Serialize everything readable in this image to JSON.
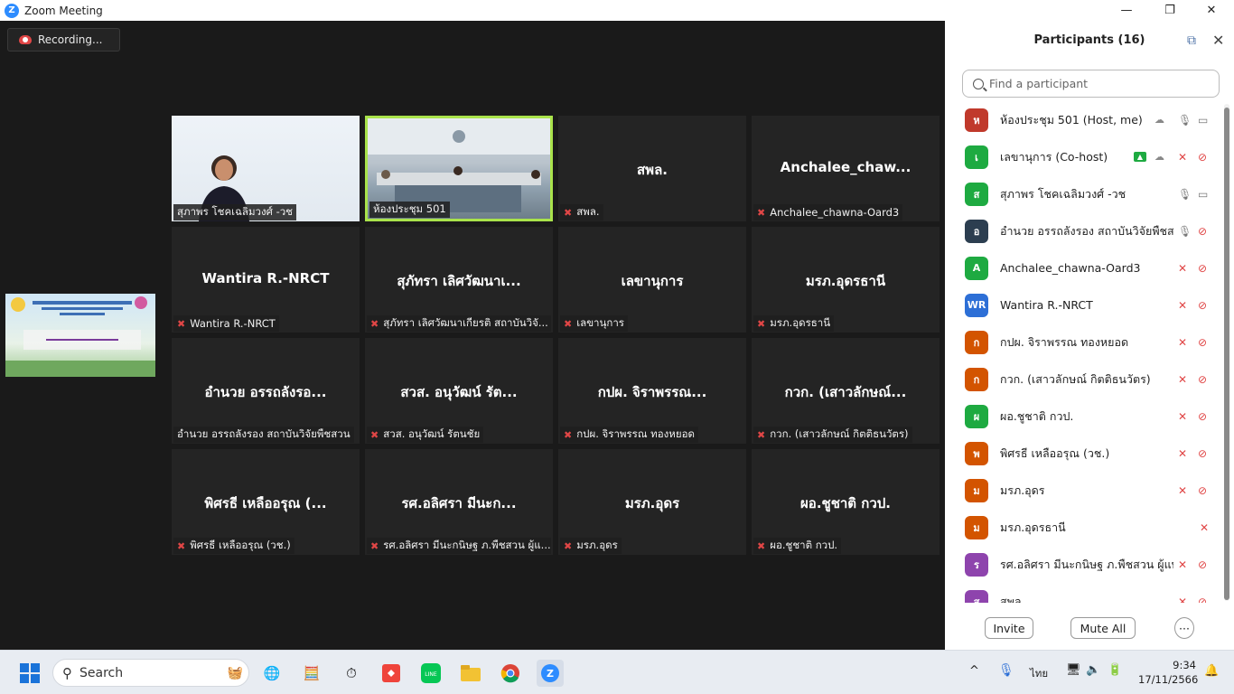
{
  "window": {
    "title": "Zoom Meeting",
    "minimize": "—",
    "restore": "❐",
    "close": "✕"
  },
  "recording": {
    "label": "Recording..."
  },
  "tiles": [
    {
      "name": "สุภาพร โชคเฉลิมวงศ์ -วช",
      "big": "",
      "muted": false,
      "video": "video1"
    },
    {
      "name": "ห้องประชุม 501",
      "big": "",
      "muted": false,
      "video": "video2"
    },
    {
      "name": "สพล.",
      "big": "สพล.",
      "muted": true
    },
    {
      "name": "Anchalee_chawna-Oard3",
      "big": "Anchalee_chaw...",
      "muted": true
    },
    {
      "name": "Wantira R.-NRCT",
      "big": "Wantira R.-NRCT",
      "muted": true
    },
    {
      "name": "สุภัทรา เลิศวัฒนาเกียรติ สถาบันวิจั...",
      "big": "สุภัทรา เลิศวัฒนาเ...",
      "muted": true
    },
    {
      "name": "เลขานุการ",
      "big": "เลขานุการ",
      "muted": true
    },
    {
      "name": "มรภ.อุดรธานี",
      "big": "มรภ.อุดรธานี",
      "muted": true
    },
    {
      "name": "อำนวย อรรถลังรอง สถาบันวิจัยพืชสวน",
      "big": "อำนวย อรรถลังรอ...",
      "muted": false
    },
    {
      "name": "สวส. อนุวัฒน์ รัตนชัย",
      "big": "สวส. อนุวัฒน์ รัต...",
      "muted": true
    },
    {
      "name": "กปผ.  จิราพรรณ ทองหยอด",
      "big": "กปผ.  จิราพรรณ...",
      "muted": true
    },
    {
      "name": "กวก. (เสาวลักษณ์ กิตติธนวัตร)",
      "big": "กวก. (เสาวลักษณ์...",
      "muted": true
    },
    {
      "name": "พิศรธี เหลืออรุณ (วช.)",
      "big": "พิศรธี เหลืออรุณ (...",
      "muted": true
    },
    {
      "name": "รศ.อลิศรา มีนะกนิษฐ ภ.พืชสวน ผู้แ...",
      "big": "รศ.อลิศรา มีนะก...",
      "muted": true
    },
    {
      "name": "มรภ.อุดร",
      "big": "มรภ.อุดร",
      "muted": true
    },
    {
      "name": "ผอ.ชูชาติ กวป.",
      "big": "ผอ.ชูชาติ กวป.",
      "muted": true
    }
  ],
  "panel": {
    "title": "Participants (16)",
    "search_placeholder": "Find a participant",
    "invite": "Invite",
    "mute_all": "Mute All",
    "more": "···",
    "participants": [
      {
        "initial": "ห",
        "color": "#c0392b",
        "name": "ห้องประชุม 501 (Host, me)",
        "mic": "on",
        "cam": "on",
        "cloud": true,
        "share": false
      },
      {
        "initial": "เ",
        "color": "#1eaa41",
        "name": "เลขานุการ (Co-host)",
        "mic": "off",
        "cam": "off",
        "cloud": true,
        "share": true
      },
      {
        "initial": "ส",
        "color": "#1eaa41",
        "name": "สุภาพร โชคเฉลิมวงศ์ -วช",
        "mic": "on",
        "cam": "on",
        "cloud": false,
        "share": false
      },
      {
        "initial": "อ",
        "color": "#2c3e50",
        "name": "อำนวย อรรถลังรอง สถาบันวิจัยพืชสวน",
        "mic": "on",
        "cam": "off",
        "cloud": false,
        "share": false
      },
      {
        "initial": "A",
        "color": "#1eaa41",
        "name": "Anchalee_chawna-Oard3",
        "mic": "off",
        "cam": "off",
        "cloud": false,
        "share": false
      },
      {
        "initial": "WR",
        "color": "#2d6fd6",
        "name": "Wantira R.-NRCT",
        "mic": "off",
        "cam": "off",
        "cloud": false,
        "share": false
      },
      {
        "initial": "ก",
        "color": "#d35400",
        "name": "กปผ.  จิราพรรณ ทองหยอด",
        "mic": "off",
        "cam": "off",
        "cloud": false,
        "share": false
      },
      {
        "initial": "ก",
        "color": "#d35400",
        "name": "กวก. (เสาวลักษณ์ กิตติธนวัตร)",
        "mic": "off",
        "cam": "off",
        "cloud": false,
        "share": false
      },
      {
        "initial": "ผ",
        "color": "#1eaa41",
        "name": "ผอ.ชูชาติ กวป.",
        "mic": "off",
        "cam": "off",
        "cloud": false,
        "share": false
      },
      {
        "initial": "พ",
        "color": "#d35400",
        "name": "พิศรธี เหลืออรุณ (วช.)",
        "mic": "off",
        "cam": "off",
        "cloud": false,
        "share": false
      },
      {
        "initial": "ม",
        "color": "#d35400",
        "name": "มรภ.อุดร",
        "mic": "off",
        "cam": "off",
        "cloud": false,
        "share": false
      },
      {
        "initial": "ม",
        "color": "#d35400",
        "name": "มรภ.อุดรธานี",
        "mic": "off",
        "cam": "none",
        "cloud": false,
        "share": false
      },
      {
        "initial": "ร",
        "color": "#8e44ad",
        "name": "รศ.อลิศรา มีนะกนิษฐ ภ.พืชสวน ผู้แท...",
        "mic": "off",
        "cam": "off",
        "cloud": false,
        "share": false
      },
      {
        "initial": "ส",
        "color": "#8e44ad",
        "name": "สพล.",
        "mic": "off",
        "cam": "off",
        "cloud": false,
        "share": false
      }
    ]
  },
  "taskbar": {
    "search": "Search",
    "lang": "ไทย",
    "time": "9:34",
    "date": "17/11/2566"
  }
}
